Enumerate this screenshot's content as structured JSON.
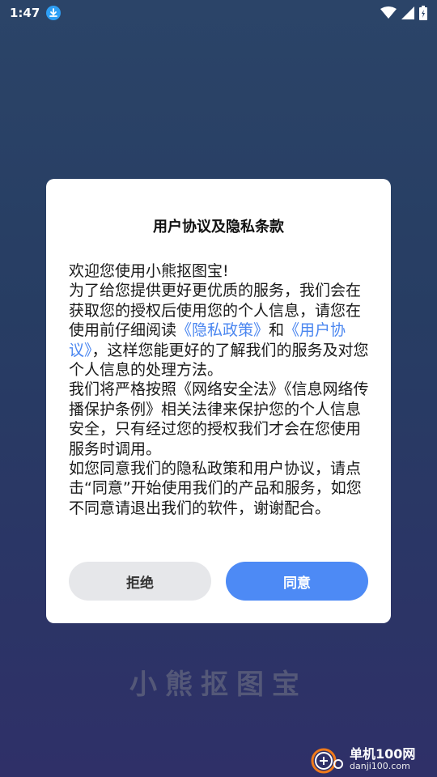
{
  "status_bar": {
    "time": "1:47"
  },
  "dialog": {
    "title": "用户协议及隐私条款",
    "welcome": "欢迎您使用小熊抠图宝!",
    "p1_a": "为了给您提供更好更优质的服务，我们会在获取您的授权后使用您的个人信息，请您在使用前仔细阅读",
    "p1_link1": "《隐私政策》",
    "p1_and": "和",
    "p1_link2": "《用户协议》",
    "p1_b": "，这样您能更好的了解我们的服务及对您个人信息的处理方法。",
    "p2": "我们将严格按照《网络安全法》《信息网络传播保护条例》相关法律来保护您的个人信息安全，只有经过您的授权我们才会在您使用服务时调用。",
    "p3": "如您同意我们的隐私政策和用户协议，请点击“同意”开始使用我们的产品和服务，如您不同意请退出我们的软件，谢谢配合。",
    "reject_label": "拒绝",
    "agree_label": "同意"
  },
  "background": {
    "app_name": "小熊抠图宝"
  },
  "watermark": {
    "name": "单机100网",
    "url": "danji100.com"
  },
  "colors": {
    "link": "#4a86f0",
    "agree_button": "#4d8af5",
    "reject_button": "#e6e7ea"
  }
}
